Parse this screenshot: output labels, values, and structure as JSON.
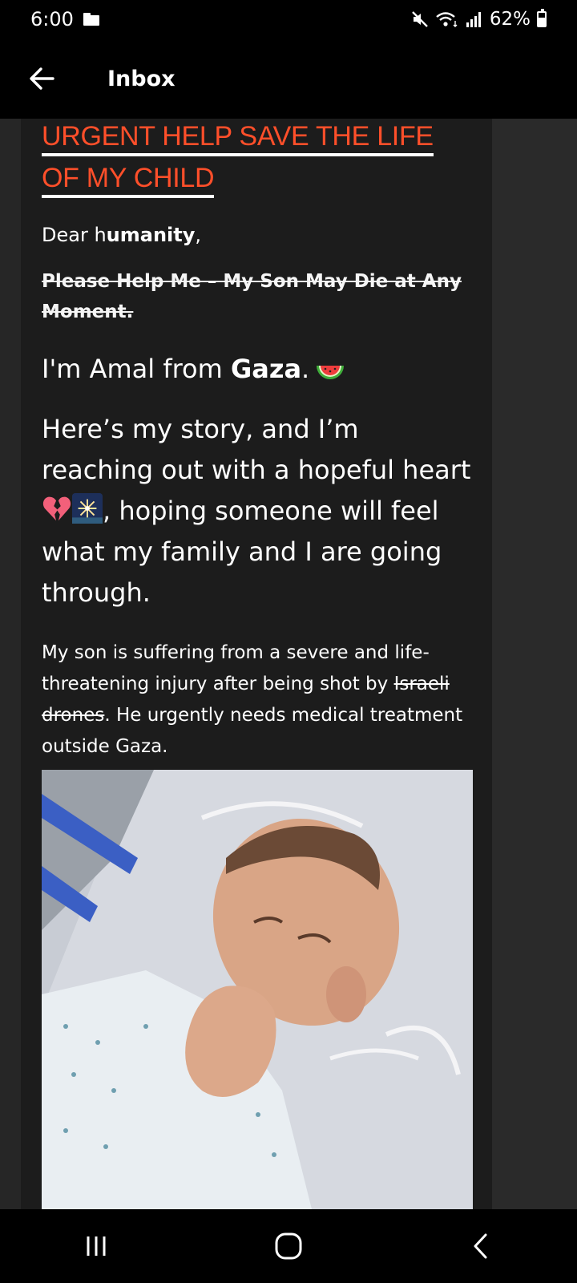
{
  "status_bar": {
    "time": "6:00",
    "battery_percent": "62%",
    "icons": [
      "folder-icon",
      "mute-icon",
      "wifi-icon",
      "signal-icon",
      "battery-icon"
    ]
  },
  "app_bar": {
    "title": "Inbox",
    "back_icon": "arrow-left-icon"
  },
  "message": {
    "headline_line1": "URGENT HELP SAVE THE LIFE",
    "headline_line2": "OF MY CHILD",
    "greeting_prefix": "Dear h",
    "greeting_bold": "umanity",
    "greeting_suffix": ",",
    "struck_line1": "Please Help Me – My Son May Die at Any",
    "struck_line2": "Moment.",
    "intro_prefix": "I'm Amal from ",
    "intro_bold": "Gaza",
    "intro_suffix": ".",
    "intro_emoji": "watermelon-emoji",
    "story_part1": "Here’s my story, and I’m reaching out with a hopeful heart ",
    "story_emojis": [
      "broken-heart-emoji",
      "fireworks-emoji"
    ],
    "story_part2": ", hoping someone will feel what my family and I are going through.",
    "body_part1": "My son is suffering from a severe and life-threatening injury after being shot by ",
    "body_struck": "Israeli drones",
    "body_part2": ". He urgently needs medical treatment outside Gaza."
  },
  "nav_bar": {
    "icons": [
      "recent-apps-icon",
      "home-icon",
      "back-icon"
    ]
  },
  "colors": {
    "headline": "#ff4f2a",
    "background": "#262626",
    "card": "#1c1c1c",
    "bars": "#000000"
  }
}
